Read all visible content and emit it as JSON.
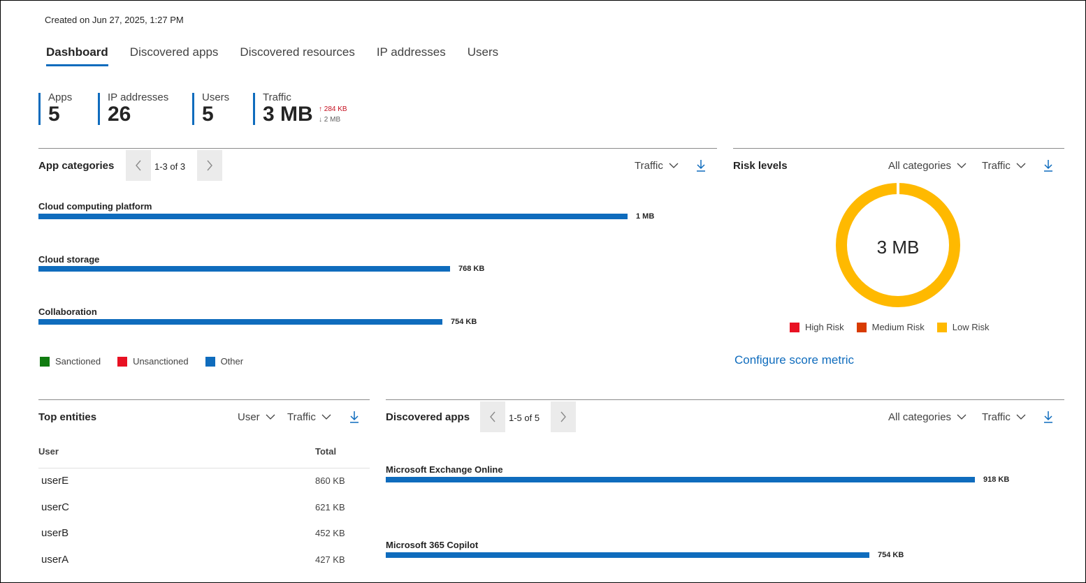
{
  "meta": {
    "created": "Created on Jun 27, 2025, 1:27 PM"
  },
  "tabs": [
    "Dashboard",
    "Discovered apps",
    "Discovered resources",
    "IP addresses",
    "Users"
  ],
  "kpis": {
    "apps": {
      "label": "Apps",
      "value": "5"
    },
    "ips": {
      "label": "IP addresses",
      "value": "26"
    },
    "users": {
      "label": "Users",
      "value": "5"
    },
    "traffic": {
      "label": "Traffic",
      "value": "3 MB",
      "upload": "284 KB",
      "download": "2 MB"
    }
  },
  "app_categories": {
    "title": "App categories",
    "pager": "1-3 of 3",
    "metric": "Traffic",
    "items": [
      {
        "label": "Cloud computing platform",
        "value_text": "1 MB",
        "value_kb": 1100
      },
      {
        "label": "Cloud storage",
        "value_text": "768 KB",
        "value_kb": 768
      },
      {
        "label": "Collaboration",
        "value_text": "754 KB",
        "value_kb": 754
      }
    ],
    "legend": [
      {
        "label": "Sanctioned",
        "color": "#107c10"
      },
      {
        "label": "Unsanctioned",
        "color": "#e81123"
      },
      {
        "label": "Other",
        "color": "#0f6cbd"
      }
    ]
  },
  "risk_levels": {
    "title": "Risk levels",
    "category_filter": "All categories",
    "metric": "Traffic",
    "center": "3 MB",
    "slices": [
      {
        "label": "High Risk",
        "color": "#e81123",
        "share": 0
      },
      {
        "label": "Medium Risk",
        "color": "#d83b01",
        "share": 0
      },
      {
        "label": "Low Risk",
        "color": "#ffb900",
        "share": 1
      }
    ],
    "link": "Configure score metric"
  },
  "top_entities": {
    "title": "Top entities",
    "entity_filter": "User",
    "metric": "Traffic",
    "columns": [
      "User",
      "Total"
    ],
    "rows": [
      {
        "user": "userE",
        "total": "860 KB"
      },
      {
        "user": "userC",
        "total": "621 KB"
      },
      {
        "user": "userB",
        "total": "452 KB"
      },
      {
        "user": "userA",
        "total": "427 KB"
      }
    ]
  },
  "discovered_apps": {
    "title": "Discovered apps",
    "pager": "1-5 of 5",
    "category_filter": "All categories",
    "metric": "Traffic",
    "items": [
      {
        "label": "Microsoft Exchange Online",
        "value_text": "918 KB",
        "value_kb": 918
      },
      {
        "label": "Microsoft 365 Copilot",
        "value_text": "754 KB",
        "value_kb": 754
      }
    ]
  },
  "colors": {
    "accent": "#0f6cbd",
    "low_risk": "#ffb900"
  },
  "icons": [
    "chevron-left-icon",
    "chevron-right-icon",
    "chevron-down-icon",
    "download-icon",
    "arrow-up-icon",
    "arrow-down-icon"
  ]
}
